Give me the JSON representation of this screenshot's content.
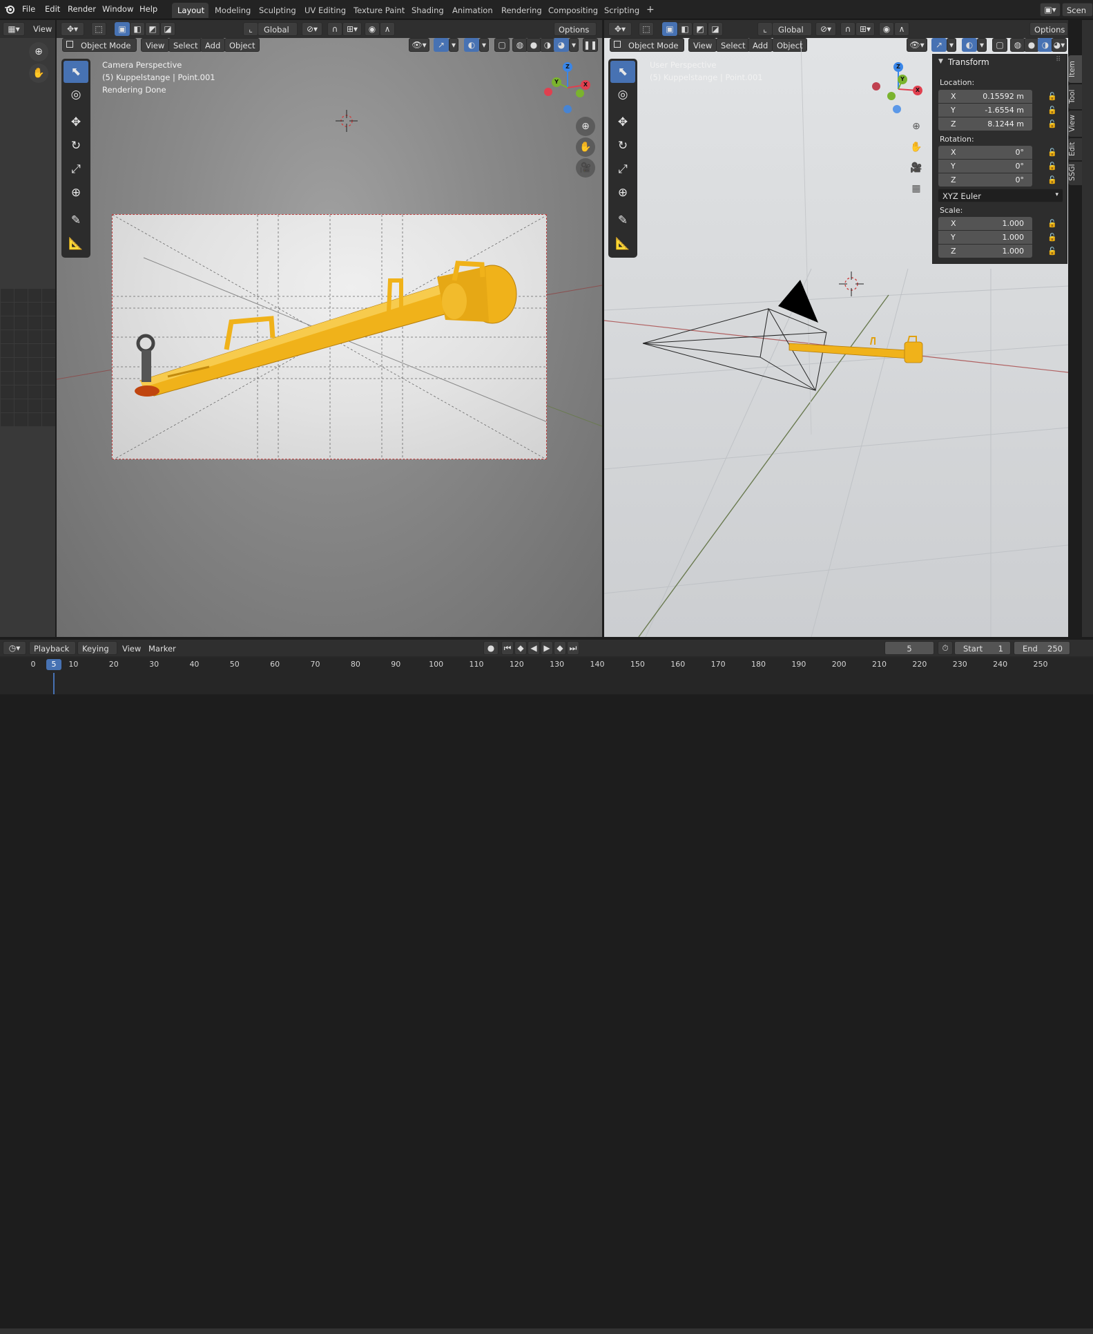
{
  "menu": [
    "File",
    "Edit",
    "Render",
    "Window",
    "Help"
  ],
  "workspaces": [
    {
      "label": "Layout",
      "active": true
    },
    {
      "label": "Modeling"
    },
    {
      "label": "Sculpting"
    },
    {
      "label": "UV Editing"
    },
    {
      "label": "Texture Paint"
    },
    {
      "label": "Shading"
    },
    {
      "label": "Animation"
    },
    {
      "label": "Rendering"
    },
    {
      "label": "Compositing"
    },
    {
      "label": "Scripting"
    }
  ],
  "add_tab": "+",
  "scene_label": "Scen",
  "left_strip": {
    "view_label": "View"
  },
  "left_view": {
    "transform_orientation": "Global",
    "options_label": "Options",
    "mode": "Object Mode",
    "menus": [
      "View",
      "Select",
      "Add",
      "Object"
    ],
    "info_line1": "Camera Perspective",
    "info_line2": "(5) Kuppelstange | Point.001",
    "info_line3": "Rendering Done"
  },
  "right_view": {
    "transform_orientation": "Global",
    "options_label": "Options",
    "mode": "Object Mode",
    "menus": [
      "View",
      "Select",
      "Add",
      "Object"
    ],
    "info_line1": "User Perspective",
    "info_line2": "(5) Kuppelstange | Point.001"
  },
  "gizmo_axes": {
    "x": "X",
    "y": "Y",
    "z": "Z"
  },
  "transform_panel": {
    "title": "Transform",
    "location_label": "Location:",
    "location": [
      {
        "axis": "X",
        "value": "0.15592 m"
      },
      {
        "axis": "Y",
        "value": "-1.6554 m"
      },
      {
        "axis": "Z",
        "value": "8.1244 m"
      }
    ],
    "rotation_label": "Rotation:",
    "rotation": [
      {
        "axis": "X",
        "value": "0°"
      },
      {
        "axis": "Y",
        "value": "0°"
      },
      {
        "axis": "Z",
        "value": "0°"
      }
    ],
    "rotation_mode": "XYZ Euler",
    "scale_label": "Scale:",
    "scale": [
      {
        "axis": "X",
        "value": "1.000"
      },
      {
        "axis": "Y",
        "value": "1.000"
      },
      {
        "axis": "Z",
        "value": "1.000"
      }
    ]
  },
  "side_tabs": [
    "Item",
    "Tool",
    "View",
    "Edit",
    "SSGI"
  ],
  "timeline": {
    "menus": [
      "Playback",
      "Keying",
      "View",
      "Marker"
    ],
    "current_frame": "5",
    "start_label": "Start",
    "start": "1",
    "end_label": "End",
    "end": "250",
    "ticks": [
      "0",
      "10",
      "20",
      "30",
      "40",
      "50",
      "60",
      "70",
      "80",
      "90",
      "100",
      "110",
      "120",
      "130",
      "140",
      "150",
      "160",
      "170",
      "180",
      "190",
      "200",
      "210",
      "220",
      "230",
      "240",
      "250"
    ],
    "playhead": "5"
  },
  "colors": {
    "accent": "#4772b3",
    "object_yellow": "#f0b21a",
    "axis_x": "#e0404f",
    "axis_y": "#7ab32e",
    "axis_z": "#3a86e8"
  }
}
